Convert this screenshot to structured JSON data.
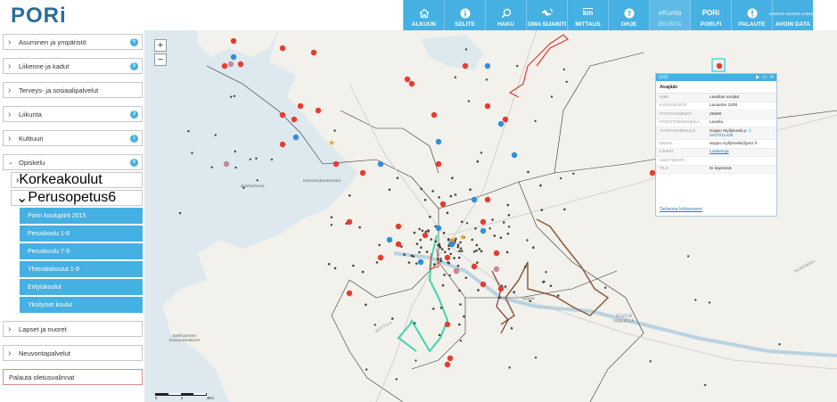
{
  "header": {
    "logo_text": "PORi",
    "toolbar": [
      {
        "name": "alkuun",
        "label": "ALKUUN",
        "icon": "home-icon"
      },
      {
        "name": "selite",
        "label": "SELITE",
        "icon": "info-icon"
      },
      {
        "name": "haku",
        "label": "HAKU",
        "icon": "search-icon"
      },
      {
        "name": "oma-sijainti",
        "label": "OMA SIJAINTI",
        "icon": "satellite-icon"
      },
      {
        "name": "mittaus",
        "label": "MITTAUS",
        "icon": "km-icon",
        "icon_text": "km"
      },
      {
        "name": "ohje",
        "label": "OHJE",
        "icon": "help-icon"
      },
      {
        "name": "ekunta",
        "label": "EKUNTA",
        "icon": "ekunta-icon",
        "icon_text": "eKunta"
      },
      {
        "name": "pori-fi",
        "label": "PORI.FI",
        "icon": "pori-logo-icon",
        "icon_text": "PORi"
      },
      {
        "name": "palaute",
        "label": "PALAUTE",
        "icon": "alert-icon"
      },
      {
        "name": "avoin-data",
        "label": "AVOIN DATA",
        "icon": "binary-icon",
        "icon_text": "1010110 1011100 1100101"
      }
    ]
  },
  "sidebar": {
    "categories": [
      {
        "label": "Asuminen ja ympäristö",
        "count": "5",
        "open": false
      },
      {
        "label": "Liikenne ja kadut",
        "count": "5",
        "open": false
      },
      {
        "label": "Terveys- ja sosiaalipalvelut",
        "count": "",
        "open": false
      },
      {
        "label": "Liikunta",
        "count": "3",
        "open": false
      },
      {
        "label": "Kulttuuri",
        "count": "1",
        "open": false
      },
      {
        "label": "Opiskelu",
        "count": "6",
        "open": true,
        "subs": [
          {
            "label": "Korkeakoulut",
            "count": "",
            "open": false
          },
          {
            "label": "Perusopetus",
            "count": "6",
            "open": true,
            "items": [
              "Porin koulupiirit 2015",
              "Peruskoulu 1-6",
              "Peruskoulu 7-9",
              "Yhtenäiskoulut 1-9",
              "Erityiskoulut",
              "Yksityiset koulut"
            ]
          }
        ]
      },
      {
        "label": "Lapset ja nuoret",
        "count": "",
        "open": false
      },
      {
        "label": "Neuvontapalvelut",
        "count": "",
        "open": false
      }
    ],
    "reset_label": "Palauta oletusvalinnat"
  },
  "map": {
    "zoom_in": "+",
    "zoom_out": "−",
    "places": [
      {
        "text": "Sekhamnen",
        "type": "place"
      },
      {
        "text": "Kaivola|Sastamala",
        "type": "place"
      },
      {
        "text": "Sekhamnen Kaivosilmäkare",
        "type": "place"
      },
      {
        "text": "Ulvila",
        "type": "place"
      },
      {
        "text": "ULVILA NAKKILA",
        "type": "road"
      },
      {
        "text": "KOKEMÄKI",
        "type": "road"
      },
      {
        "text": "KUTTILA",
        "type": "road"
      }
    ],
    "scale": [
      "0",
      "2",
      "4km"
    ],
    "colors": {
      "water": "#dde9ef",
      "land": "#f2f1ec",
      "school_red": "#e63c2e",
      "school_blue": "#2f8fdc",
      "route_green": "#3fd6b0",
      "route_brown": "#8a5d3b",
      "route_red": "#e0392e"
    }
  },
  "popup": {
    "pager": "(1/2)",
    "title": "Avajäät:",
    "rows": [
      {
        "key": "NIMI",
        "value": "Lassilan avojää"
      },
      {
        "key": "KATUOSOITE",
        "value": "Laviantie 2200"
      },
      {
        "key": "POSTINUMERO",
        "value": "29680"
      },
      {
        "key": "POSTITOIMIPAIKKA",
        "value": "Lassila"
      },
      {
        "key": "YHTEYSHENKILÖ",
        "value": "Seppo Myllykoski p.",
        "phone": "0447011436"
      },
      {
        "key": "EMAIL",
        "value": "seppo.myllykoski@pori.fi"
      },
      {
        "key": "LINKKI",
        "value": "Lisätietoja",
        "link": true
      },
      {
        "key": "LISÄTIEDOT",
        "value": ""
      },
      {
        "key": "TILA",
        "value": "Ei käytössä"
      }
    ],
    "zoom_link": "Tarkenna kohteeseen"
  }
}
